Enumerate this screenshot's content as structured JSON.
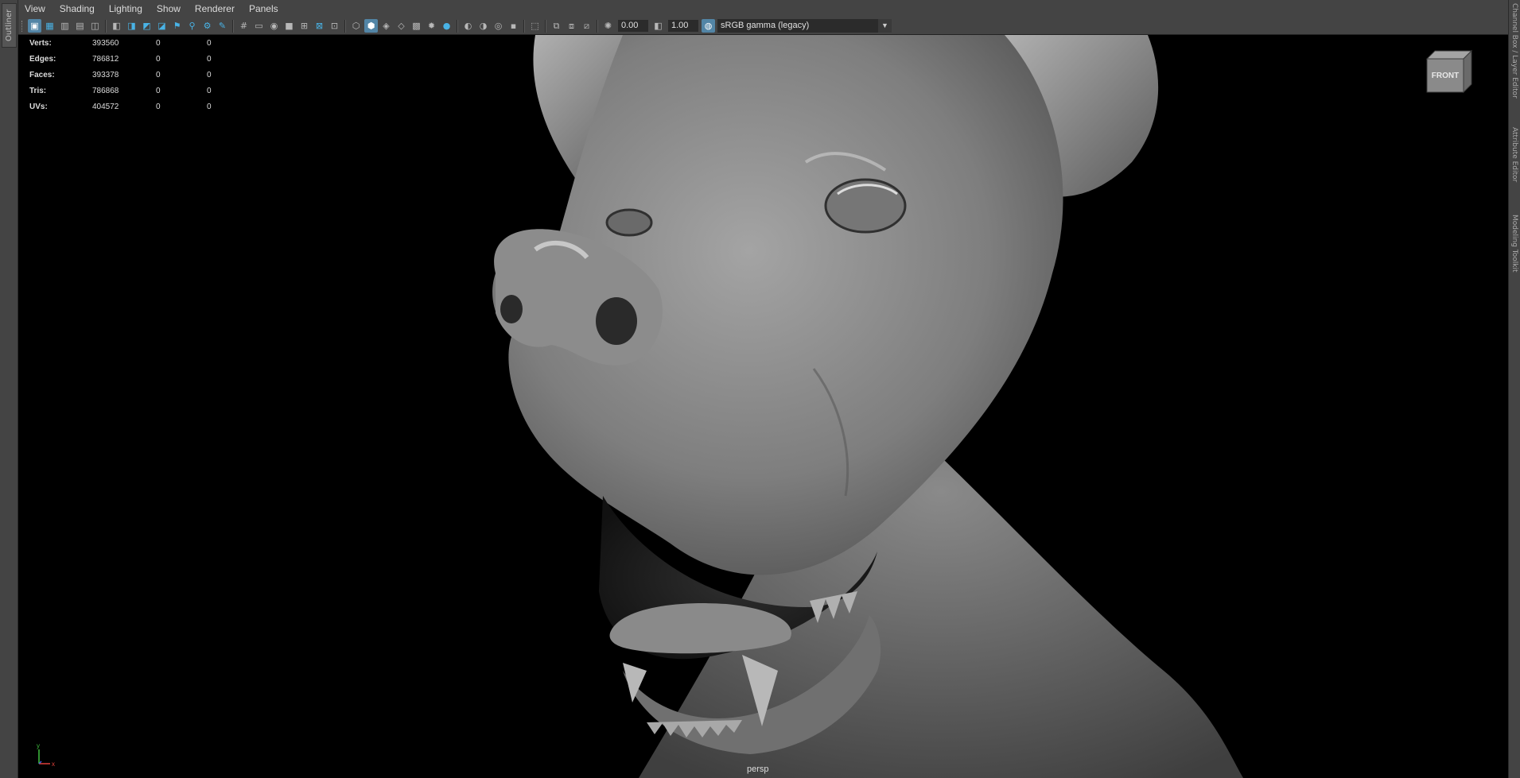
{
  "outliner_tab": "Outliner",
  "right_tabs": [
    "Channel Box / Layer Editor",
    "Attribute Editor",
    "Modeling Toolkit"
  ],
  "menu": [
    "View",
    "Shading",
    "Lighting",
    "Show",
    "Renderer",
    "Panels"
  ],
  "toolbar": {
    "exposure_value": "0.00",
    "gamma_value": "1.00",
    "color_space": "sRGB gamma (legacy)"
  },
  "hud": {
    "rows": [
      {
        "label": "Verts:",
        "value": "393560",
        "a": "0",
        "b": "0"
      },
      {
        "label": "Edges:",
        "value": "786812",
        "a": "0",
        "b": "0"
      },
      {
        "label": "Faces:",
        "value": "393378",
        "a": "0",
        "b": "0"
      },
      {
        "label": "Tris:",
        "value": "786868",
        "a": "0",
        "b": "0"
      },
      {
        "label": "UVs:",
        "value": "404572",
        "a": "0",
        "b": "0"
      }
    ]
  },
  "viewcube_label": "FRONT",
  "camera_label": "persp",
  "axis": {
    "y": "y",
    "x": "x"
  },
  "colors": {
    "accent": "#49b3e6",
    "active": "#5285a6",
    "axis_x": "#e0413c",
    "axis_y": "#3fbf3f",
    "axis_z": "#4060e0"
  }
}
